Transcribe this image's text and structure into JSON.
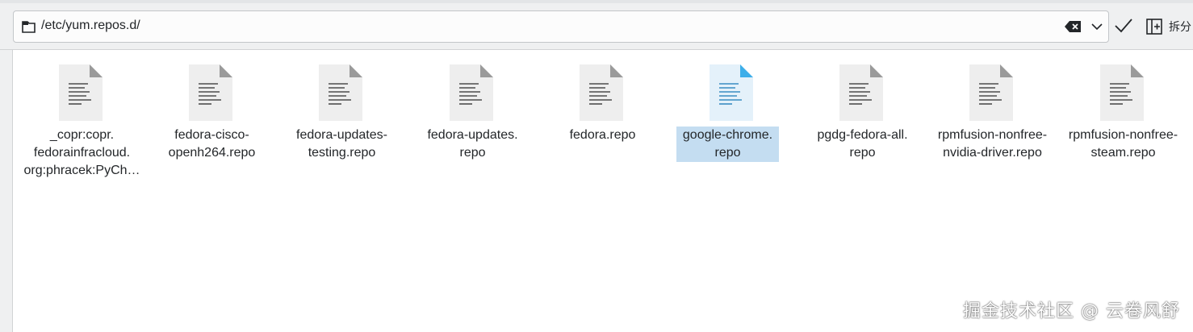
{
  "location": {
    "path": "/etc/yum.repos.d/"
  },
  "toolbar": {
    "split_label": "拆分"
  },
  "files": [
    {
      "name": "_copr:copr.\nfedorainfracloud.\norg:phracek:PyCh…",
      "selected": false
    },
    {
      "name": "fedora-cisco-\nopenh264.repo",
      "selected": false
    },
    {
      "name": "fedora-updates-\ntesting.repo",
      "selected": false
    },
    {
      "name": "fedora-updates.\nrepo",
      "selected": false
    },
    {
      "name": "fedora.repo",
      "selected": false
    },
    {
      "name": "google-chrome.\nrepo",
      "selected": true
    },
    {
      "name": "pgdg-fedora-all.\nrepo",
      "selected": false
    },
    {
      "name": "rpmfusion-nonfree-\nnvidia-driver.repo",
      "selected": false
    },
    {
      "name": "rpmfusion-nonfree-\nsteam.repo",
      "selected": false
    }
  ],
  "colors": {
    "selection": "#c4ddf1",
    "accent": "#3daee9",
    "icon_body": "#eeeeee",
    "icon_fold": "#9a9a9a"
  },
  "watermark": "掘金技术社区 @ 云卷风舒"
}
